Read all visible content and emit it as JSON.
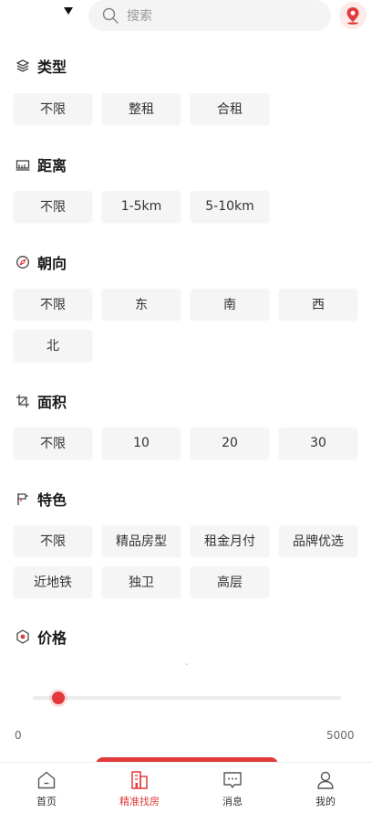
{
  "search": {
    "placeholder": "搜索"
  },
  "icons": {
    "dropdown": "caret-down-icon",
    "search": "search-icon",
    "location": "location-pin-icon"
  },
  "colors": {
    "accent": "#e23a3a",
    "chip_bg": "#f5f5f5"
  },
  "sections": {
    "type": {
      "title": "类型",
      "icon": "layers-icon",
      "options": [
        "不限",
        "整租",
        "合租"
      ]
    },
    "distance": {
      "title": "距离",
      "icon": "ruler-icon",
      "options": [
        "不限",
        "1-5km",
        "5-10km"
      ]
    },
    "orientation": {
      "title": "朝向",
      "icon": "compass-icon",
      "options": [
        "不限",
        "东",
        "南",
        "西",
        "北"
      ]
    },
    "area": {
      "title": "面积",
      "icon": "area-crop-icon",
      "options": [
        "不限",
        "10",
        "20",
        "30"
      ]
    },
    "features": {
      "title": "特色",
      "icon": "flag-icon",
      "options": [
        "不限",
        "精品房型",
        "租金月付",
        "品牌优选",
        "近地铁",
        "独卫",
        "高层"
      ]
    },
    "price": {
      "title": "价格",
      "icon": "price-tag-icon",
      "min_label": "0",
      "max_label": "5000",
      "dash": "-",
      "selected_low": 0.08
    }
  },
  "tabbar": {
    "items": [
      {
        "label": "首页",
        "icon": "home-icon",
        "active": false
      },
      {
        "label": "精准找房",
        "icon": "building-icon",
        "active": true
      },
      {
        "label": "消息",
        "icon": "message-icon",
        "active": false
      },
      {
        "label": "我的",
        "icon": "user-icon",
        "active": false
      }
    ]
  }
}
